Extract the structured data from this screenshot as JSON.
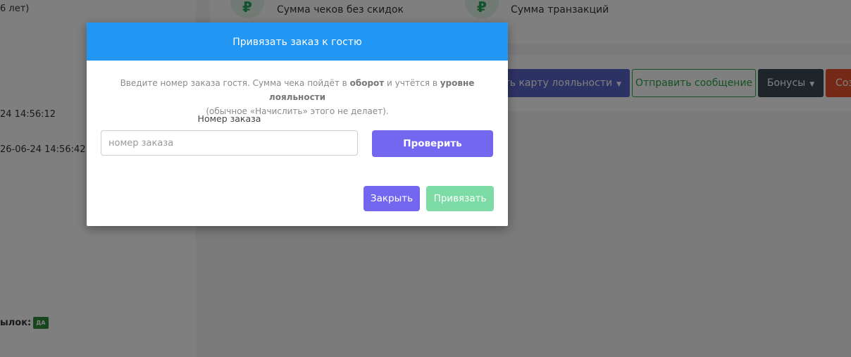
{
  "background": {
    "left_panel": {
      "age_fragment": "6 лет)",
      "timestamp_1": "24 14:56:12",
      "timestamp_2": "26-06-24 14:56:42",
      "mailing_label": "ылок:",
      "mailing_badge": "ДА"
    },
    "stats": [
      {
        "icon": "ruble-icon",
        "label": "Сумма чеков без скидок"
      },
      {
        "icon": "ruble-icon",
        "label": "Сумма транзакций"
      }
    ],
    "toolbar": {
      "loyalty_card_label": "ить карту лояльности",
      "send_message_label": "Отправить сообщение",
      "bonuses_label": "Бонусы",
      "create_label": "Соз"
    }
  },
  "modal": {
    "title": "Привязать заказ к гостю",
    "description_part1": "Введите номер заказа гостя. Сумма чека пойдёт в ",
    "description_bold1": "оборот",
    "description_part2": " и учтётся в ",
    "description_bold2": "уровне лояльности",
    "description_part3": "(обычное «Начислить» этого не делает).",
    "field_label": "Номер заказа",
    "input_value": "",
    "input_placeholder": "номер заказа",
    "check_button": "Проверить",
    "close_button": "Закрыть",
    "bind_button": "Привязать"
  },
  "colors": {
    "modal_header": "#2196f3",
    "primary": "#7367f0",
    "bind_disabled": "#7ddba6",
    "success": "#28a745",
    "danger": "#e8542e"
  }
}
